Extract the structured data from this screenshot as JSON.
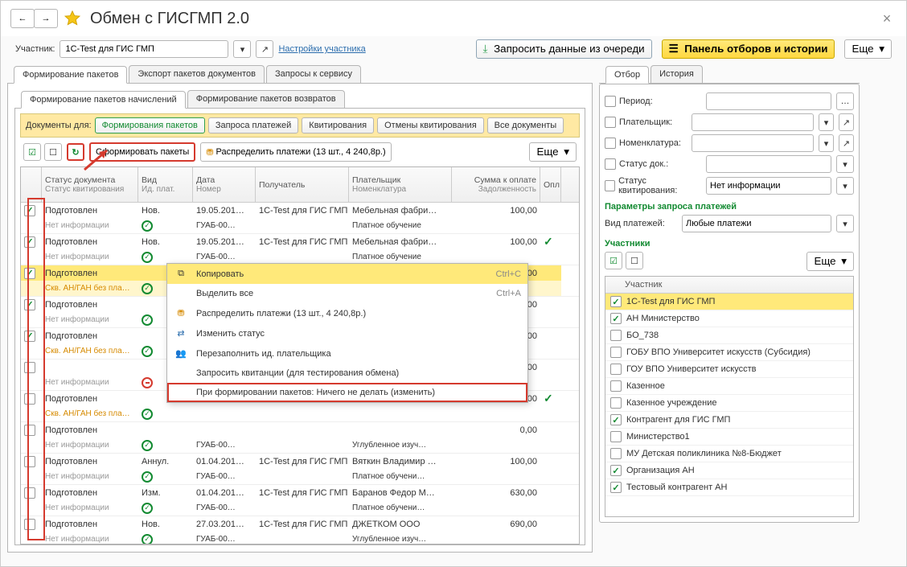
{
  "page_title": "Обмен с ГИСГМП 2.0",
  "nav": {
    "back": "←",
    "fwd": "→"
  },
  "participant": {
    "label": "Участник:",
    "value": "1C-Test для ГИС ГМП",
    "settings_link": "Настройки участника"
  },
  "top_buttons": {
    "queue": "Запросить данные из очереди",
    "panel": "Панель отборов и истории",
    "more": "Еще"
  },
  "tabs_main": [
    "Формирование пакетов",
    "Экспорт пакетов документов",
    "Запросы к сервису"
  ],
  "tabs_sub": [
    "Формирование пакетов начислений",
    "Формирование пакетов возвратов"
  ],
  "docs_for_label": "Документы для:",
  "docs_for": [
    "Формирования пакетов",
    "Запроса платежей",
    "Квитирования",
    "Отмены квитирования",
    "Все документы"
  ],
  "toolbar": {
    "make_packets": "Сформировать пакеты",
    "distribute": "Распределить платежи (13 шт., 4 240,8р.)",
    "more": "Еще"
  },
  "grid_head": {
    "c1a": "Статус документа",
    "c1b": "Статус квитирования",
    "c2a": "Вид",
    "c2b": "Ид. плат.",
    "c3a": "Дата",
    "c3b": "Номер",
    "c4a": "Получатель",
    "c4b": "",
    "c5a": "Плательщик",
    "c5b": "Номенклатура",
    "c6a": "Сумма к оплате",
    "c6b": "Задолженность",
    "c7": "Опл"
  },
  "rows": [
    {
      "chk": true,
      "stat": "Подготовлен",
      "kvit": "Нет информации",
      "kvitc": "gray",
      "okred": false,
      "vid": "Нов.",
      "date": "19.05.201…",
      "num": "ГУАБ-00…",
      "recv": "1C-Test для ГИС ГМП",
      "payer": "Мебельная фабри…",
      "nom": "Платное обучение",
      "sum": "100,00",
      "paid": false
    },
    {
      "chk": true,
      "stat": "Подготовлен",
      "kvit": "Нет информации",
      "kvitc": "gray",
      "okred": false,
      "vid": "Нов.",
      "date": "19.05.201…",
      "num": "ГУАБ-00…",
      "recv": "1C-Test для ГИС ГМП",
      "payer": "Мебельная фабри…",
      "nom": "Платное обучение",
      "sum": "100,00",
      "paid": true
    },
    {
      "chk": true,
      "sel": true,
      "stat": "Подготовлен",
      "kvit": "Скв. АН/ГАН без пла…",
      "kvitc": "orange",
      "okred": false,
      "vid": "",
      "date": "",
      "num": "",
      "recv": "",
      "payer": "",
      "nom": "",
      "sum": "0,00",
      "paid": false
    },
    {
      "chk": true,
      "stat": "Подготовлен",
      "kvit": "Нет информации",
      "kvitc": "gray",
      "okred": false,
      "vid": "",
      "date": "",
      "num": "",
      "recv": "",
      "payer": "",
      "nom": "",
      "sum": "0,00",
      "paid": false
    },
    {
      "chk": true,
      "stat": "Подготовлен",
      "kvit": "Скв. АН/ГАН без пла…",
      "kvitc": "orange",
      "okred": false,
      "vid": "",
      "date": "",
      "num": "",
      "recv": "",
      "payer": "",
      "nom": "",
      "sum": "0,00",
      "paid": false
    },
    {
      "chk": false,
      "stat": "",
      "kvit": "Нет информации",
      "kvitc": "gray",
      "okred": true,
      "vid": "",
      "date": "",
      "num": "",
      "recv": "",
      "payer": "",
      "nom": "",
      "sum": "0,00",
      "paid": false
    },
    {
      "chk": false,
      "stat": "Подготовлен",
      "kvit": "Скв. АН/ГАН без пла…",
      "kvitc": "orange",
      "okred": false,
      "vid": "",
      "date": "",
      "num": "",
      "recv": "",
      "payer": "",
      "nom": "",
      "sum": "0,00",
      "paid": true
    },
    {
      "chk": false,
      "stat": "Подготовлен",
      "kvit": "Нет информации",
      "kvitc": "gray",
      "okred": false,
      "vid": "",
      "date": "",
      "num": "ГУАБ-00…",
      "recv": "",
      "payer": "",
      "nom": "Углубленное изуч…",
      "sum": "0,00",
      "paid": false
    },
    {
      "chk": false,
      "stat": "Подготовлен",
      "kvit": "Нет информации",
      "kvitc": "gray",
      "okred": false,
      "vid": "Аннул.",
      "date": "01.04.201…",
      "num": "ГУАБ-00…",
      "recv": "1C-Test для ГИС ГМП",
      "payer": "Вяткин Владимир …",
      "nom": "Платное обучени…",
      "sum": "100,00",
      "paid": false
    },
    {
      "chk": false,
      "stat": "Подготовлен",
      "kvit": "Нет информации",
      "kvitc": "gray",
      "okred": false,
      "vid": "Изм.",
      "date": "01.04.201…",
      "num": "ГУАБ-00…",
      "recv": "1C-Test для ГИС ГМП",
      "payer": "Баранов Федор М…",
      "nom": "Платное обучени…",
      "sum": "630,00",
      "paid": false
    },
    {
      "chk": false,
      "stat": "Подготовлен",
      "kvit": "Нет информации",
      "kvitc": "gray",
      "okred": false,
      "vid": "Нов.",
      "date": "27.03.201…",
      "num": "ГУАБ-00…",
      "recv": "1C-Test для ГИС ГМП",
      "payer": "ДЖЕТКОМ ООО",
      "nom": "Углубленное изуч…",
      "sum": "690,00",
      "paid": false
    }
  ],
  "ctx": {
    "copy": "Копировать",
    "copy_sc": "Ctrl+C",
    "select_all": "Выделить все",
    "select_all_sc": "Ctrl+A",
    "distribute": "Распределить платежи (13 шт., 4 240,8р.)",
    "change_status": "Изменить статус",
    "refill": "Перезаполнить ид. плательщика",
    "receipts": "Запросить квитанции (для тестирования обмена)",
    "on_form": "При формировании пакетов: Ничего не делать (изменить)"
  },
  "right": {
    "tabs": [
      "Отбор",
      "История"
    ],
    "period": "Период:",
    "payer": "Плательщик:",
    "nom": "Номенклатура:",
    "doc_status": "Статус док.:",
    "kvit_status": "Статус квитирования:",
    "kvit_status_val": "Нет информации",
    "params_title": "Параметры запроса платежей",
    "pay_kind_label": "Вид платежей:",
    "pay_kind_val": "Любые платежи",
    "participants_title": "Участники",
    "more": "Еще",
    "part_head": "Участник",
    "parts": [
      {
        "chk": true,
        "name": "1C-Test для ГИС ГМП",
        "sel": true
      },
      {
        "chk": true,
        "name": "АН Министерство"
      },
      {
        "chk": false,
        "name": "БО_738"
      },
      {
        "chk": false,
        "name": "ГОБУ ВПО Университет искусств (Субсидия)"
      },
      {
        "chk": false,
        "name": "ГОУ ВПО Университет искусств"
      },
      {
        "chk": false,
        "name": "Казенное"
      },
      {
        "chk": false,
        "name": "Казенное учреждение"
      },
      {
        "chk": true,
        "name": "Контрагент для ГИС ГМП"
      },
      {
        "chk": false,
        "name": "Министерство1"
      },
      {
        "chk": false,
        "name": "МУ Детская поликлиника №8-Бюджет"
      },
      {
        "chk": true,
        "name": "Организация АН"
      },
      {
        "chk": true,
        "name": "Тестовый контрагент АН"
      }
    ]
  }
}
